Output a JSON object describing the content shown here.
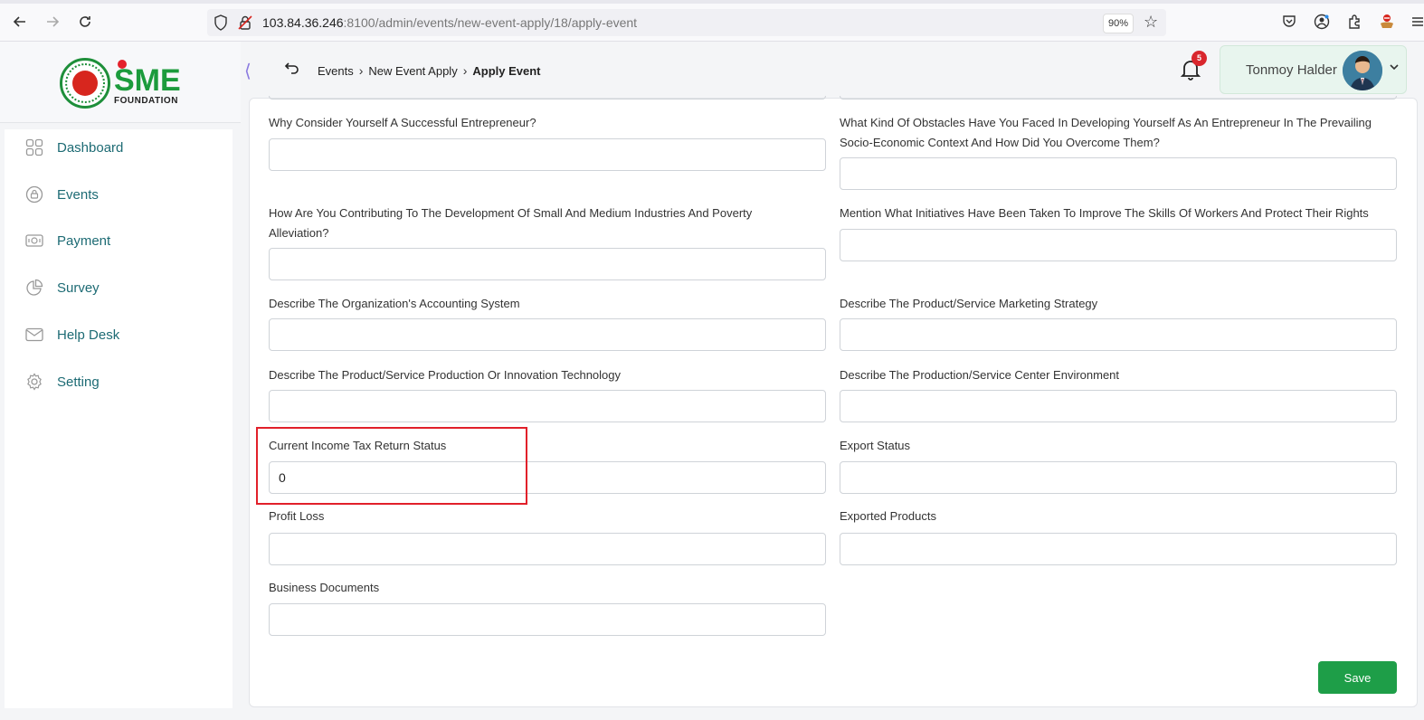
{
  "browser": {
    "url_host": "103.84.36.246",
    "url_rest": ":8100/admin/events/new-event-apply/18/apply-event",
    "zoom": "90%"
  },
  "logo": {
    "text": "SME",
    "subtitle": "FOUNDATION"
  },
  "sidebar": {
    "items": [
      {
        "label": "Dashboard",
        "icon": "dashboard-icon"
      },
      {
        "label": "Events",
        "icon": "events-icon"
      },
      {
        "label": "Payment",
        "icon": "payment-icon"
      },
      {
        "label": "Survey",
        "icon": "survey-icon"
      },
      {
        "label": "Help Desk",
        "icon": "mail-icon"
      },
      {
        "label": "Setting",
        "icon": "gear-icon"
      }
    ]
  },
  "header": {
    "breadcrumb": [
      "Events",
      "New Event Apply",
      "Apply Event"
    ],
    "notifications": "5",
    "user_name": "Tonmoy Halder"
  },
  "form": {
    "fields": [
      {
        "label": "Why Consider Yourself A Successful Entrepreneur?",
        "value": ""
      },
      {
        "label": "What Kind Of Obstacles Have You Faced In Developing Yourself As An Entrepreneur In The Prevailing Socio-Economic Context And How Did You Overcome Them?",
        "value": ""
      },
      {
        "label": "How Are You Contributing To The Development Of Small And Medium Industries And Poverty Alleviation?",
        "value": ""
      },
      {
        "label": "Mention What Initiatives Have Been Taken To Improve The Skills Of Workers And Protect Their Rights",
        "value": ""
      },
      {
        "label": "Describe The Organization's Accounting System",
        "value": ""
      },
      {
        "label": "Describe The Product/Service Marketing Strategy",
        "value": ""
      },
      {
        "label": "Describe The Product/Service Production Or Innovation Technology",
        "value": ""
      },
      {
        "label": "Describe The Production/Service Center Environment",
        "value": ""
      },
      {
        "label": "Current Income Tax Return Status",
        "value": "0"
      },
      {
        "label": "Export Status",
        "value": ""
      },
      {
        "label": "Profit Loss",
        "value": ""
      },
      {
        "label": "Exported Products",
        "value": ""
      },
      {
        "label": "Business Documents",
        "value": ""
      }
    ],
    "save_label": "Save"
  }
}
